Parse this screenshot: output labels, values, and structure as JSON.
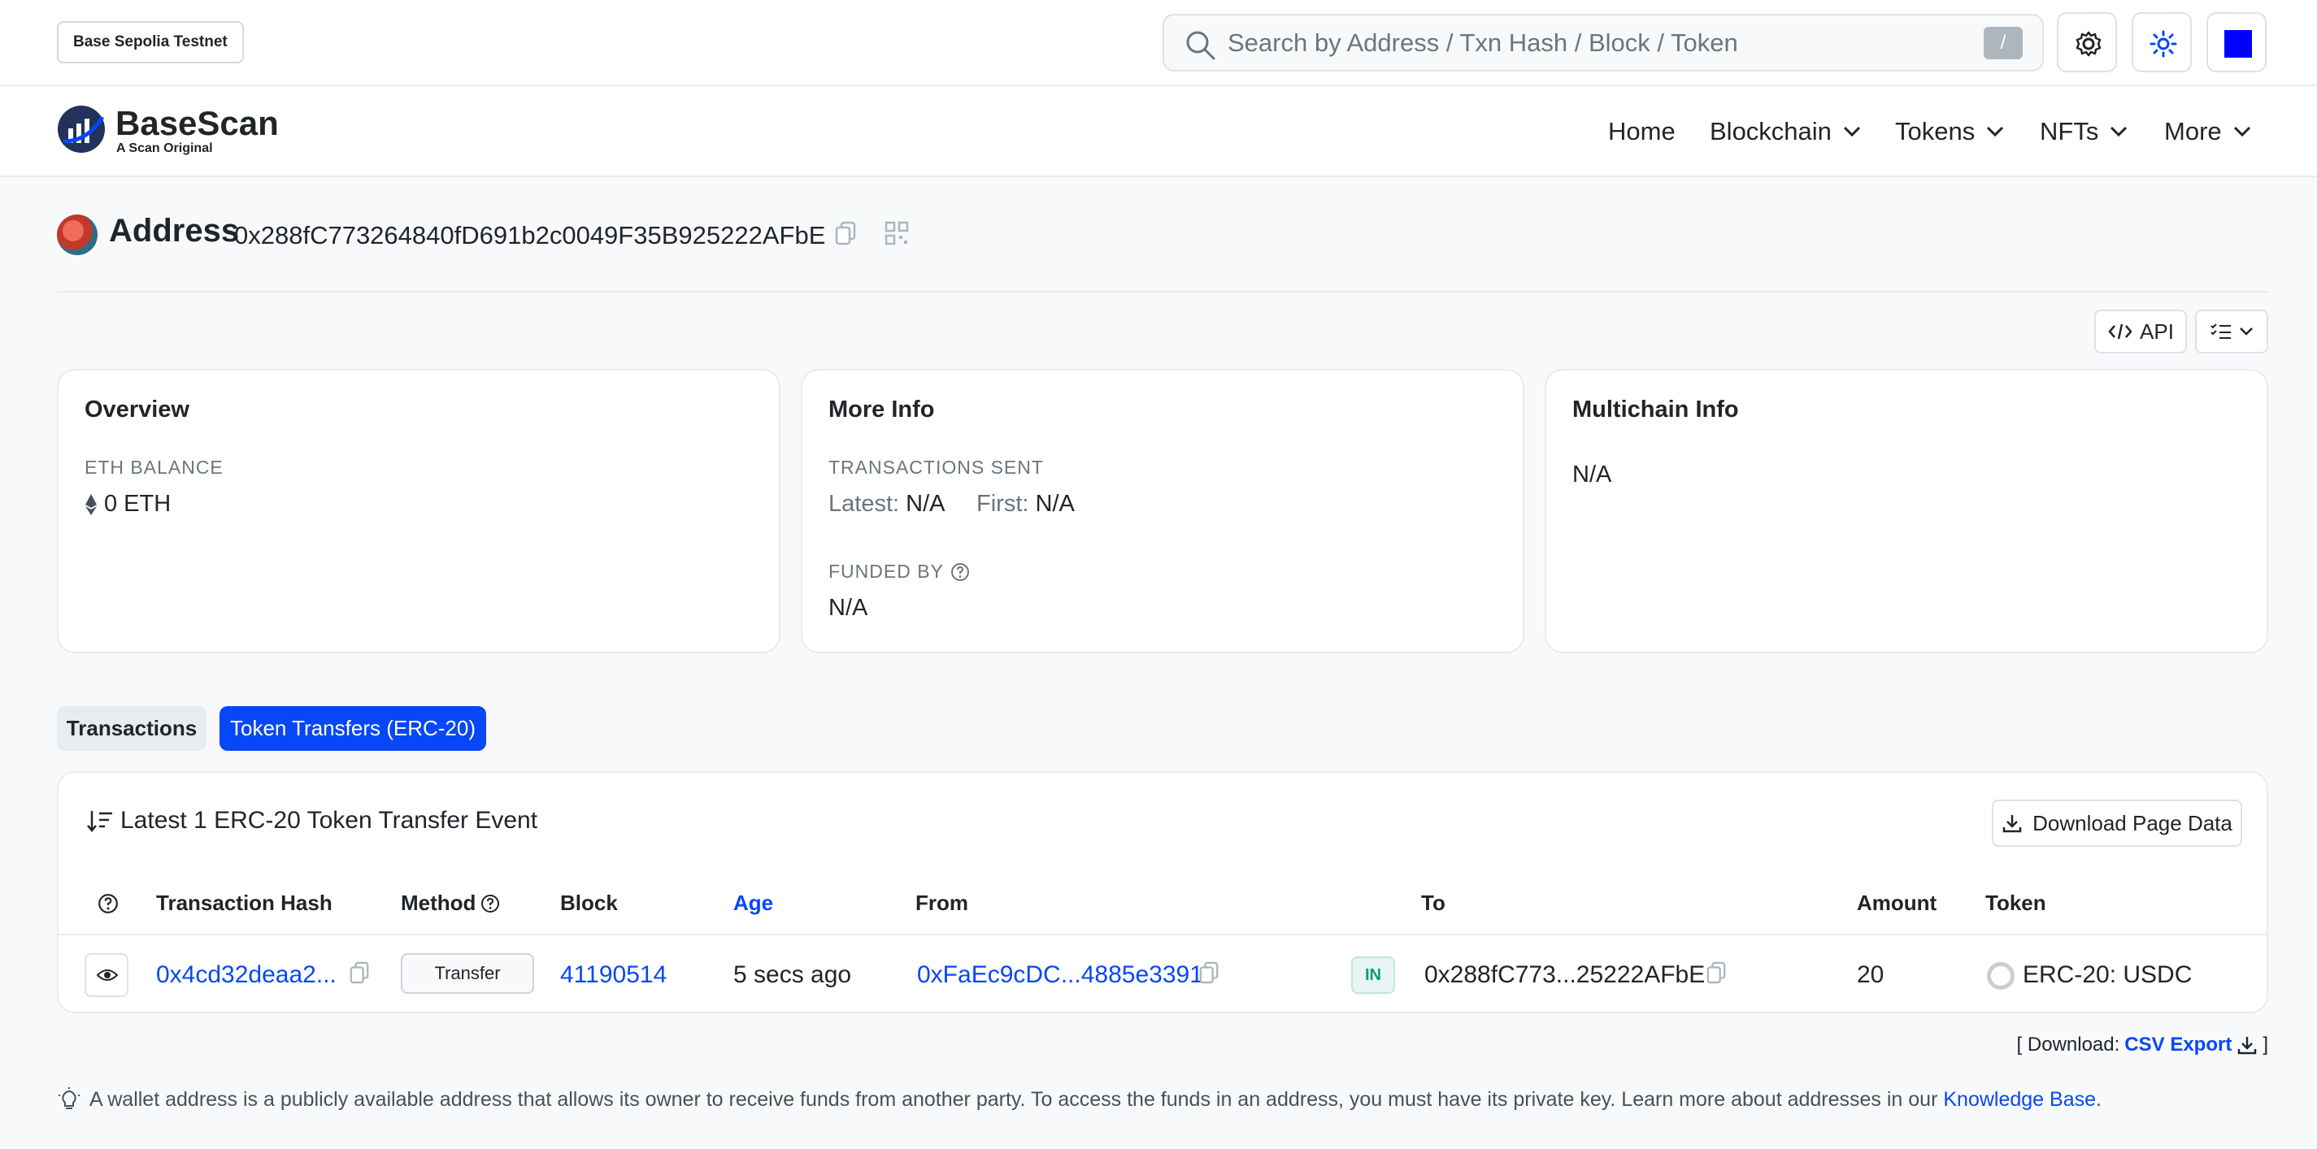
{
  "network_badge": "Base Sepolia Testnet",
  "search": {
    "placeholder": "Search by Address / Txn Hash / Block / Token",
    "shortcut": "/"
  },
  "brand": {
    "name": "BaseScan",
    "tagline": "A Scan Original"
  },
  "nav": [
    "Home",
    "Blockchain",
    "Tokens",
    "NFTs",
    "More"
  ],
  "address": {
    "title": "Address",
    "hash": "0x288fC773264840fD691b2c0049F35B925222AFbE"
  },
  "toolbar": {
    "api_label": "API"
  },
  "overview": {
    "title": "Overview",
    "balance_label": "ETH BALANCE",
    "balance_value": "0 ETH"
  },
  "more_info": {
    "title": "More Info",
    "tx_sent_label": "TRANSACTIONS SENT",
    "latest_label": "Latest:",
    "latest_value": "N/A",
    "first_label": "First:",
    "first_value": "N/A",
    "funded_by_label": "FUNDED BY",
    "funded_by_value": "N/A"
  },
  "multichain": {
    "title": "Multichain Info",
    "value": "N/A"
  },
  "tabs": [
    {
      "label": "Transactions",
      "active": false
    },
    {
      "label": "Token Transfers (ERC-20)",
      "active": true
    }
  ],
  "table": {
    "title": "Latest 1 ERC-20 Token Transfer Event",
    "download_label": "Download Page Data",
    "headers": [
      "Transaction Hash",
      "Method",
      "Block",
      "Age",
      "From",
      "To",
      "Amount",
      "Token"
    ],
    "rows": [
      {
        "tx_hash": "0x4cd32deaa2...",
        "method": "Transfer",
        "block": "41190514",
        "age": "5 secs ago",
        "from": "0xFaEc9cDC...4885e3391",
        "direction": "IN",
        "to": "0x288fC773...25222AFbE",
        "amount": "20",
        "token": "ERC-20: USDC"
      }
    ]
  },
  "csv": {
    "prefix": "[ Download:",
    "link": "CSV Export",
    "suffix": "]"
  },
  "footnote": {
    "text": "A wallet address is a publicly available address that allows its owner to receive funds from another party. To access the funds in an address, you must have its private key. Learn more about addresses in our",
    "link": "Knowledge Base",
    "end": "."
  },
  "colors": {
    "accent": "#0847f7",
    "in_badge": "#0b9a7c"
  }
}
